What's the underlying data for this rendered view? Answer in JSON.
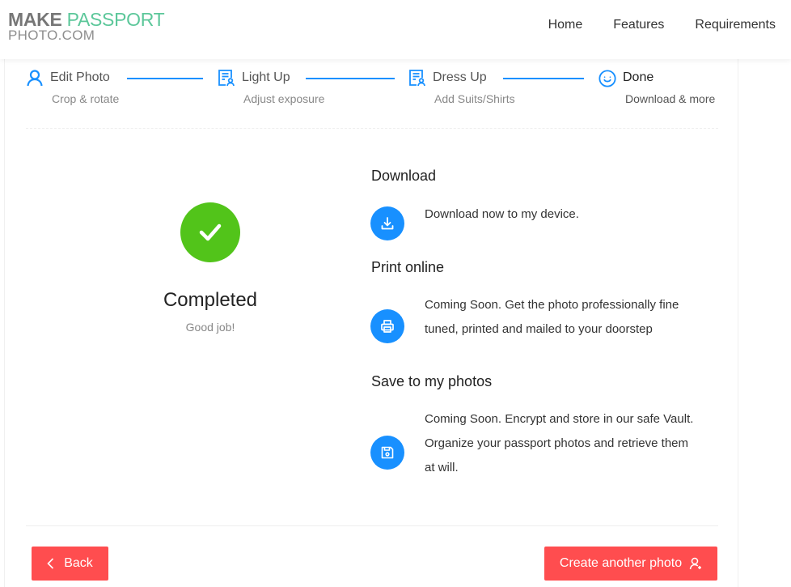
{
  "brand": {
    "line1_make": "MAKE",
    "line1_passport": "PASSPORT",
    "line2": "PHOTO.COM",
    "colors": {
      "make": "#777777",
      "passport": "#5cc79a",
      "line2": "#8e8e8e"
    }
  },
  "nav": {
    "items": [
      {
        "label": "Home"
      },
      {
        "label": "Features"
      },
      {
        "label": "Requirements"
      }
    ]
  },
  "steps": [
    {
      "title": "Edit Photo",
      "description": "Crop & rotate",
      "icon": "user-icon",
      "status": "finished"
    },
    {
      "title": "Light Up",
      "description": "Adjust exposure",
      "icon": "solution-icon",
      "status": "finished"
    },
    {
      "title": "Dress Up",
      "description": "Add Suits/Shirts",
      "icon": "solution-icon",
      "status": "finished"
    },
    {
      "title": "Done",
      "description": "Download & more",
      "icon": "smile-icon",
      "status": "current"
    }
  ],
  "result": {
    "title": "Completed",
    "subtitle": "Good job!",
    "icon": "check-circle-icon",
    "color": "#52c41a"
  },
  "sections": [
    {
      "title": "Download",
      "icon": "download-icon",
      "text": "Download now to my device."
    },
    {
      "title": "Print online",
      "icon": "printer-icon",
      "text": "Coming Soon. Get the photo professionally fine tuned, printed and mailed to your doorstep"
    },
    {
      "title": "Save to my photos",
      "icon": "save-icon",
      "text": "Coming Soon. Encrypt and store in our safe Vault. Organize your passport photos and retrieve them at will."
    }
  ],
  "buttons": {
    "back": "Back",
    "create": "Create another photo"
  },
  "colors": {
    "primary": "#1890ff",
    "danger": "#ff4d4f",
    "success": "#52c41a"
  }
}
